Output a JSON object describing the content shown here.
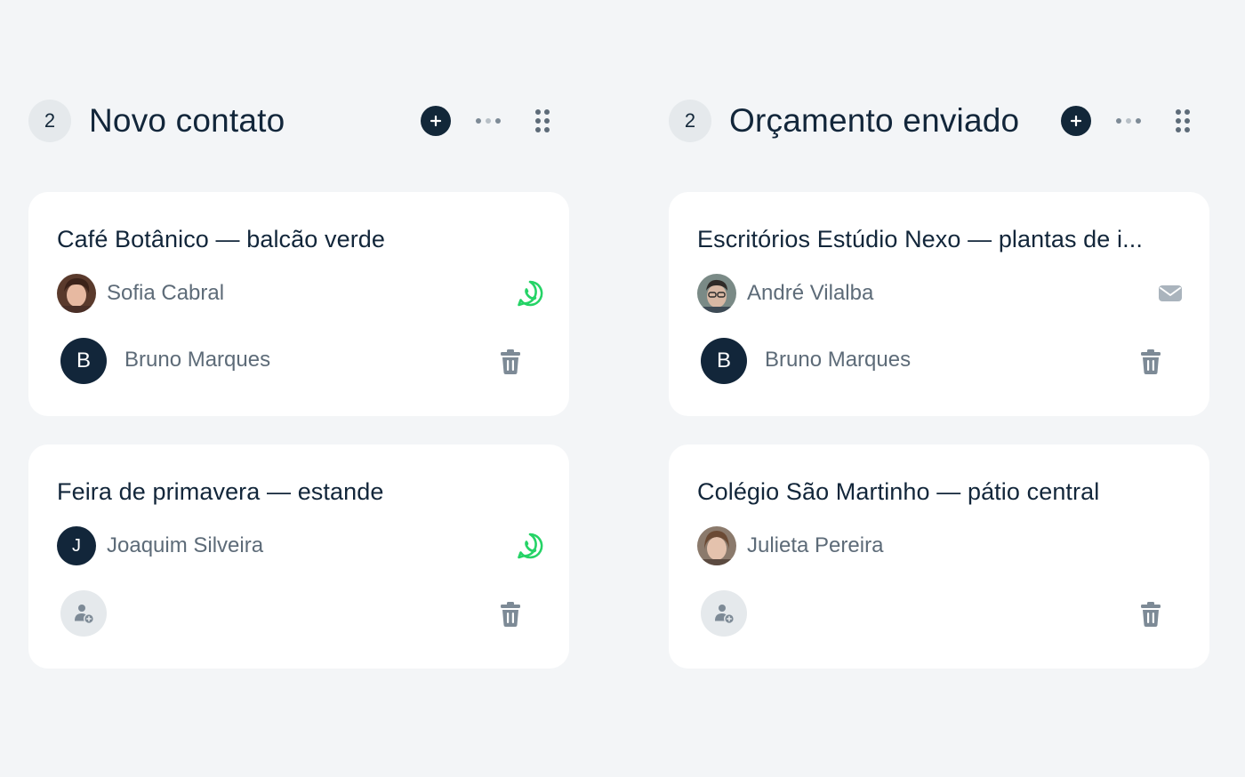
{
  "columns": [
    {
      "count": "2",
      "title": "Novo contato",
      "cards": [
        {
          "title": "Café Botânico — balcão verde",
          "contact": {
            "name": "Sofia Cabral",
            "avatar": "photo",
            "channel": "whatsapp-icon"
          },
          "owner": {
            "name": "Bruno Marques",
            "initial": "B"
          }
        },
        {
          "title": "Feira de primavera — estande",
          "contact": {
            "name": "Joaquim Silveira",
            "avatar": "initial",
            "initial": "J",
            "channel": "whatsapp-icon"
          },
          "owner": null
        }
      ]
    },
    {
      "count": "2",
      "title": "Orçamento enviado",
      "cards": [
        {
          "title": "Escritórios Estúdio Nexo — plantas de i...",
          "contact": {
            "name": "André Vilalba",
            "avatar": "photo",
            "channel": "mail-icon"
          },
          "owner": {
            "name": "Bruno Marques",
            "initial": "B"
          }
        },
        {
          "title": "Colégio São Martinho — pátio central",
          "contact": {
            "name": "Julieta Pereira",
            "avatar": "photo",
            "channel": "none"
          },
          "owner": null
        }
      ]
    }
  ],
  "colors": {
    "background": "#f3f5f7",
    "card": "#ffffff",
    "primary": "#12263a",
    "muted_text": "#5d6b78",
    "icon_gray": "#7d8a96",
    "whatsapp": "#25d366",
    "badge_bg": "#e5e9ec"
  }
}
